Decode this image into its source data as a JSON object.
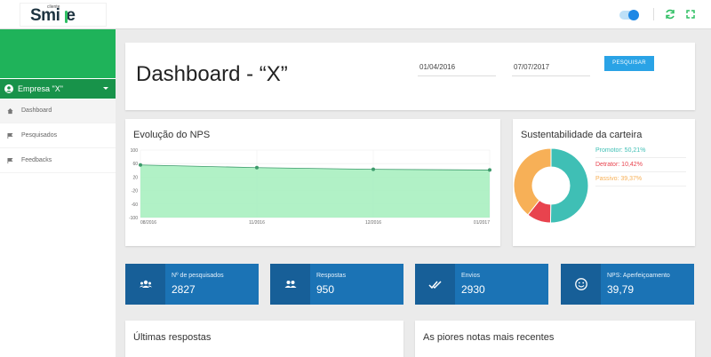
{
  "logo": {
    "small": "cliente",
    "big": "Smi",
    "big_end": "e"
  },
  "sidebar": {
    "company": "Empresa \"X\"",
    "items": [
      {
        "label": "Dashboard",
        "icon": "home-icon"
      },
      {
        "label": "Pesquisados",
        "icon": "flag-icon"
      },
      {
        "label": "Feedbacks",
        "icon": "flag-icon"
      }
    ]
  },
  "header": {
    "title": "Dashboard - “X”",
    "date_start": "01/04/2016",
    "date_end": "07/07/2017",
    "search_button": "PESQUISAR"
  },
  "nps_card": {
    "title": "Evolução do NPS",
    "y_ticks": [
      "100",
      "60",
      "20",
      "-20",
      "-60",
      "-100"
    ],
    "x_ticks": [
      "08/2016",
      "11/2016",
      "12/2016",
      "01/2017"
    ]
  },
  "sustain_card": {
    "title": "Sustentabilidade da carteira",
    "legend": [
      {
        "label": "Promotor: 50,21%",
        "value": 50.21,
        "color": "#3fbfb5"
      },
      {
        "label": "Detrator: 10,42%",
        "value": 10.42,
        "color": "#e8434e"
      },
      {
        "label": "Passivo: 39,37%",
        "value": 39.37,
        "color": "#f7b057"
      }
    ]
  },
  "stats": [
    {
      "label": "Nº de pesquisados",
      "value": "2827",
      "icon": "users-icon"
    },
    {
      "label": "Respostas",
      "value": "950",
      "icon": "group-icon"
    },
    {
      "label": "Envios",
      "value": "2930",
      "icon": "double-check-icon"
    },
    {
      "label": "NPS: Aperfeiçoamento",
      "value": "39,79",
      "icon": "smile-icon"
    }
  ],
  "bottom": {
    "left_title": "Últimas respostas",
    "right_title": "As piores notas mais recentes"
  },
  "chart_data": {
    "type": "area",
    "x": [
      "08/2016",
      "11/2016",
      "12/2016",
      "01/2017"
    ],
    "series": [
      {
        "values": [
          56,
          48,
          43,
          41
        ]
      }
    ],
    "ylim": [
      -100,
      100
    ],
    "fill_color": "#a8f0c0",
    "line_color": "#3d9a6b",
    "grid": true
  }
}
